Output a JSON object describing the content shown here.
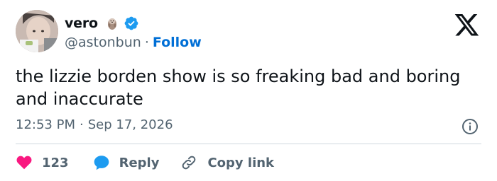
{
  "user": {
    "display_name": "vero",
    "handle": "@astonbun",
    "separator": "·",
    "follow_label": "Follow"
  },
  "tweet": {
    "text": "the lizzie borden show is so freaking bad and boring and inaccurate",
    "time": "12:53 PM",
    "separator": "·",
    "date": "Sep 17, 2026"
  },
  "actions": {
    "like_count": "123",
    "reply_label": "Reply",
    "copy_link_label": "Copy link"
  },
  "icons": {
    "logo": "x-logo-icon",
    "verified": "verified-badge-icon",
    "emoji": "otter-emoji-icon",
    "info": "info-icon",
    "like": "heart-icon",
    "reply": "speech-bubble-icon",
    "copy": "link-icon"
  },
  "colors": {
    "like": "#f91880",
    "reply": "#1d9bf0",
    "follow": "#006fd6",
    "verified": "#1d9bf0",
    "secondary_text": "#536471",
    "divider": "#cfd9de"
  }
}
